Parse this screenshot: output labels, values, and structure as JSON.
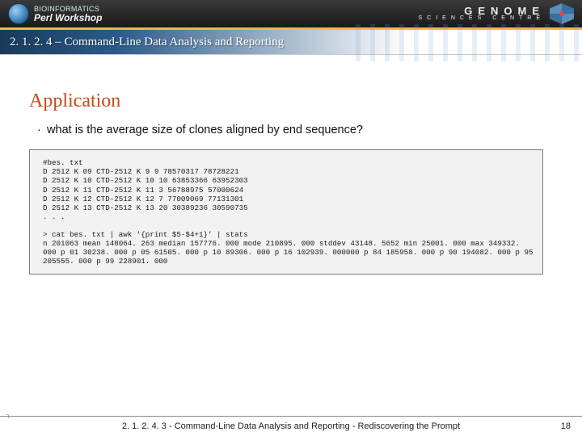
{
  "brand": {
    "top": "BIOINFORMATICS",
    "bottom": "Perl Workshop"
  },
  "gsc": {
    "line1": "GENOME",
    "line2": "SCIENCES CENTRE"
  },
  "section_number": "2. 1. 2. 4 – Command-Line Data Analysis and Reporting",
  "heading": "Application",
  "bullet": "what is the average size of clones aligned by end sequence?",
  "code_block1": "#bes. txt\nD 2512 K 09 CTD-2512 K 9 9 78570317 78728221\nD 2512 K 10 CTD-2512 K 10 10 63853366 63952303\nD 2512 K 11 CTD-2512 K 11 3 56788975 57000624\nD 2512 K 12 CTD-2512 K 12 7 77009069 77131301\nD 2512 K 13 CTD-2512 K 13 20 30389236 30590735\n. . .",
  "code_block2": "> cat bes. txt | awk '{print $5-$4+1}' | stats\nn 201063 mean 148064. 263 median 157776. 000 mode 210895. 000 stddev 43148. 5652 min 25001. 000 max 349332. 000 p 01 30238. 000 p 05 61505. 000 p 10 89306. 000 p 16 102939. 000000 p 84 185958. 000 p 90 194082. 000 p 95 205555. 000 p 99 228901. 000",
  "footer": "2. 1. 2. 4. 3 - Command-Line Data Analysis and Reporting - Rediscovering the Prompt",
  "page": "18"
}
